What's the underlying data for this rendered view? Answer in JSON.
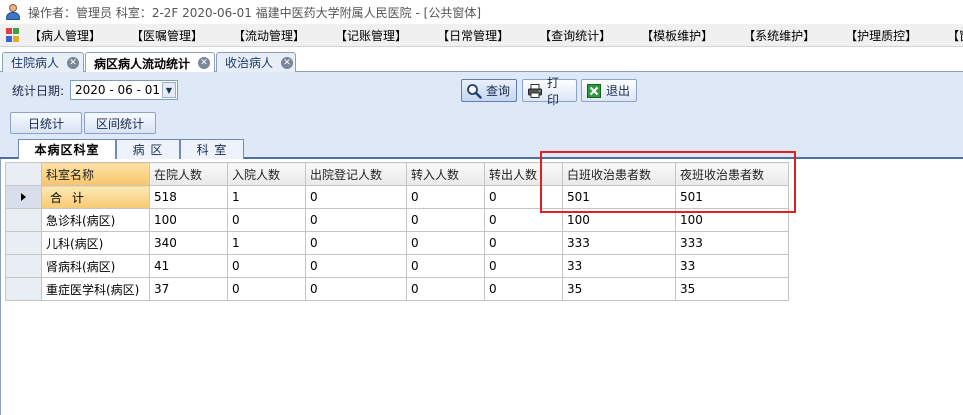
{
  "window": {
    "title": "操作者：管理员  科室：2-2F  2020-06-01  福建中医药大学附属人民医院 - [公共窗体]"
  },
  "menu": {
    "items": [
      {
        "label": "【病人管理】"
      },
      {
        "label": "【医嘱管理】"
      },
      {
        "label": "【流动管理】"
      },
      {
        "label": "【记账管理】"
      },
      {
        "label": "【日常管理】"
      },
      {
        "label": "【查询统计】"
      },
      {
        "label": "【模板维护】"
      },
      {
        "label": "【系统维护】"
      },
      {
        "label": "【护理质控】"
      },
      {
        "label": "【窗口】"
      }
    ]
  },
  "doc_tabs": [
    {
      "label": "住院病人",
      "active": false
    },
    {
      "label": "病区病人流动统计",
      "active": true
    },
    {
      "label": "收治病人",
      "active": false
    }
  ],
  "toolbar": {
    "date_label": "统计日期:",
    "date_value": "2020 - 06 - 01",
    "query_label": "查询",
    "print_label": "打印",
    "exit_label": "退出",
    "daily_label": "日统计",
    "range_label": "区间统计"
  },
  "view_tabs": [
    {
      "label": "本病区科室",
      "active": true
    },
    {
      "label": "病 区",
      "active": false
    },
    {
      "label": "科 室",
      "active": false
    }
  ],
  "table": {
    "columns": [
      "科室名称",
      "在院人数",
      "入院人数",
      "出院登记人数",
      "转入人数",
      "转出人数",
      "白班收治患者数",
      "夜班收治患者数"
    ],
    "rows": [
      [
        "合 计",
        "518",
        "1",
        "0",
        "0",
        "0",
        "501",
        "501"
      ],
      [
        "急诊科(病区)",
        "100",
        "0",
        "0",
        "0",
        "0",
        "100",
        "100"
      ],
      [
        "儿科(病区)",
        "340",
        "1",
        "0",
        "0",
        "0",
        "333",
        "333"
      ],
      [
        "肾病科(病区)",
        "41",
        "0",
        "0",
        "0",
        "0",
        "33",
        "33"
      ],
      [
        "重症医学科(病区)",
        "37",
        "0",
        "0",
        "0",
        "0",
        "35",
        "35"
      ]
    ]
  },
  "colors": {
    "highlight": "#e02020",
    "toolbar_bg": "#dfe8f6",
    "name_header": "#f9c46b"
  }
}
